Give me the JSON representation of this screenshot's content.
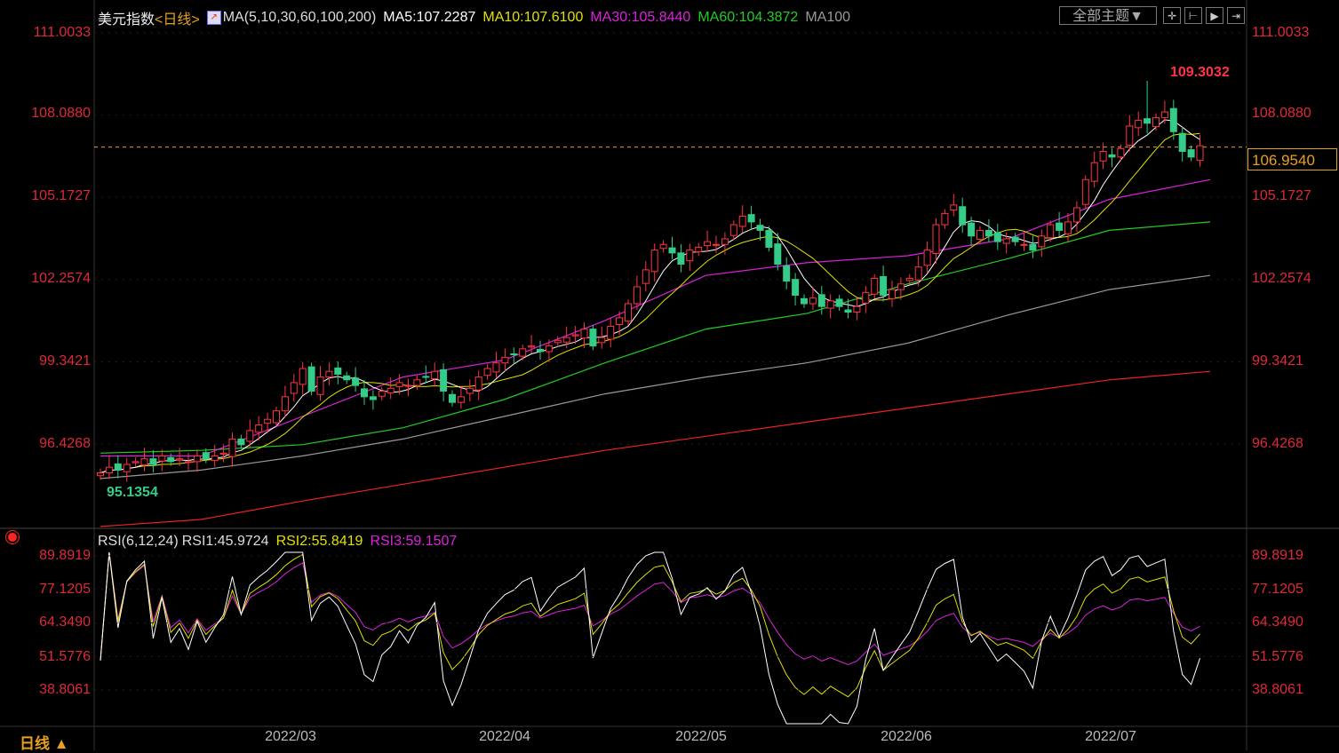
{
  "header": {
    "title": "美元指数",
    "period": "<日线>",
    "ma_params": "MA(5,10,30,60,100,200)",
    "ma5": "MA5:107.2287",
    "ma10": "MA10:107.6100",
    "ma30": "MA30:105.8440",
    "ma60": "MA60:104.3872",
    "ma100": "MA100",
    "theme_select": "全部主题▼"
  },
  "rsi_header": {
    "params": "RSI(6,12,24)",
    "rsi1": "RSI1:45.9724",
    "rsi2": "RSI2:55.8419",
    "rsi3": "RSI3:59.1507"
  },
  "footer": {
    "period": "日线 ▲"
  },
  "colors": {
    "up": "#ff3344",
    "down": "#33cc88",
    "ma5": "#ffffff",
    "ma10": "#e0e000",
    "ma30": "#dd22dd",
    "ma60": "#22cc22",
    "ma100": "#999999",
    "ma200": "#ee2222",
    "axis": "#e0283a"
  },
  "chart_data": [
    {
      "type": "candlestick",
      "title": "美元指数 日线",
      "yticks": [
        "111.0033",
        "108.0880",
        "105.1727",
        "102.2574",
        "99.3421",
        "96.4268"
      ],
      "ylim": [
        93.3,
        111.6
      ],
      "xticks": [
        "2022/03",
        "2022/04",
        "2022/05",
        "2022/06",
        "2022/07"
      ],
      "high_label": "109.3032",
      "low_label": "95.1354",
      "last_price": "106.9540",
      "last_value": 106.954,
      "closes": [
        95.4,
        95.6,
        95.5,
        95.7,
        95.8,
        95.9,
        95.7,
        96.0,
        95.8,
        95.9,
        95.8,
        96.0,
        95.9,
        96.0,
        96.1,
        96.6,
        96.4,
        96.9,
        97.1,
        97.3,
        97.6,
        98.1,
        98.6,
        99.1,
        98.3,
        98.8,
        99.0,
        98.9,
        98.7,
        98.5,
        98.1,
        98.0,
        98.3,
        98.4,
        98.6,
        98.5,
        98.7,
        98.8,
        99.0,
        98.3,
        97.9,
        98.1,
        98.4,
        98.8,
        99.1,
        99.3,
        99.5,
        99.6,
        99.8,
        99.9,
        99.7,
        99.9,
        100.1,
        100.2,
        100.3,
        100.5,
        99.9,
        100.2,
        100.6,
        100.9,
        101.4,
        102.0,
        102.6,
        103.3,
        103.5,
        103.2,
        102.8,
        103.3,
        103.4,
        103.6,
        103.5,
        103.7,
        104.2,
        104.5,
        104.3,
        104.0,
        103.4,
        102.8,
        102.2,
        101.7,
        101.4,
        101.6,
        101.3,
        101.5,
        101.3,
        101.1,
        101.3,
        101.8,
        102.3,
        101.7,
        101.9,
        102.1,
        102.3,
        102.7,
        103.3,
        104.2,
        104.6,
        104.9,
        104.2,
        103.8,
        104.0,
        103.8,
        103.6,
        103.7,
        103.6,
        103.5,
        103.3,
        103.8,
        104.2,
        104.0,
        104.3,
        104.8,
        105.8,
        106.4,
        106.8,
        106.6,
        106.9,
        107.7,
        107.9,
        107.8,
        108.0,
        108.2,
        107.5,
        106.8,
        106.6,
        107.0
      ],
      "ma_long": {
        "ma30": [
          96.0,
          96.0,
          97.4,
          98.8,
          99.4,
          100.8,
          102.4,
          102.85,
          103.1,
          103.7,
          105.1,
          105.8
        ],
        "ma60": [
          96.1,
          96.2,
          96.4,
          97.0,
          98.0,
          99.3,
          100.5,
          101.05,
          102.1,
          103.0,
          104.0,
          104.3
        ],
        "ma100": [
          95.2,
          95.5,
          96.0,
          96.6,
          97.4,
          98.2,
          98.8,
          99.3,
          100.0,
          101.0,
          101.9,
          102.4
        ],
        "ma200": [
          93.5,
          93.75,
          94.4,
          95.0,
          95.6,
          96.2,
          96.7,
          97.2,
          97.7,
          98.2,
          98.7,
          99.0
        ]
      }
    },
    {
      "type": "line",
      "title": "RSI(6,12,24)",
      "yticks": [
        "89.8919",
        "77.1205",
        "64.3490",
        "51.5776",
        "38.8061"
      ],
      "ylim": [
        29,
        96
      ],
      "series": [
        "RSI1",
        "RSI2",
        "RSI3"
      ]
    }
  ]
}
